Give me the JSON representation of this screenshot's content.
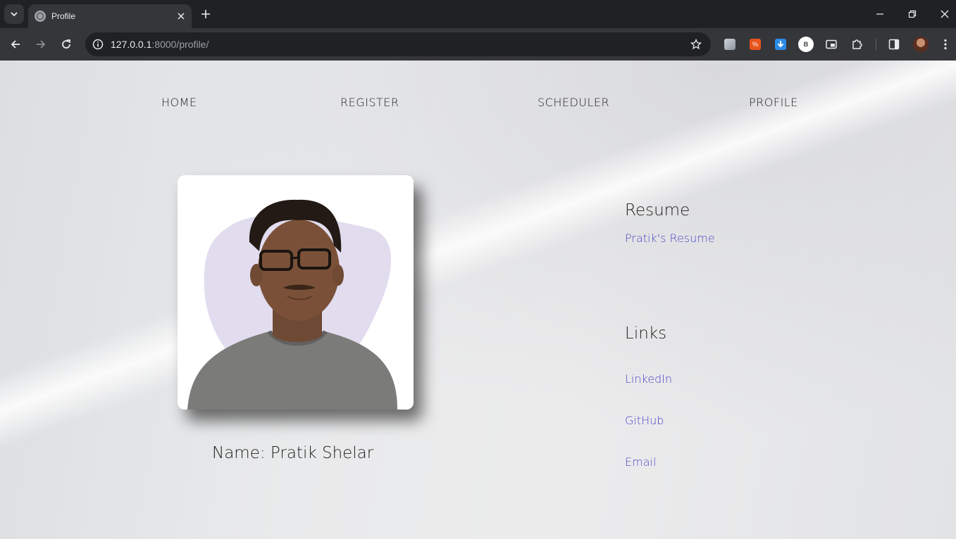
{
  "browser": {
    "tab_title": "Profile",
    "url_host": "127.0.0.1",
    "url_rest": ":8000/profile/",
    "extensions": [
      "hand-extension-icon",
      "percent-extension-icon",
      "download-extension-icon",
      "b-extension-icon",
      "media-extension-icon",
      "puzzle-icon"
    ],
    "ext_b_label": "B"
  },
  "nav": {
    "home": "HOME",
    "register": "REGISTER",
    "scheduler": "SCHEDULER",
    "profile": "PROFILE"
  },
  "profile": {
    "name": "Name: Pratik Shelar"
  },
  "resume": {
    "title": "Resume",
    "link": "Pratik's Resume"
  },
  "links": {
    "title": "Links",
    "linkedin": "LinkedIn",
    "github": "GitHub",
    "email": "Email"
  },
  "colors": {
    "link": "#4a47c8",
    "chrome_dark": "#202124",
    "chrome_toolbar": "#35363a"
  }
}
